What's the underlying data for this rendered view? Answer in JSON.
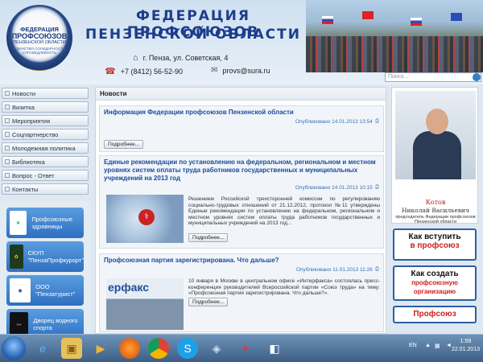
{
  "header": {
    "logo_line1": "ФЕДЕРАЦИЯ",
    "logo_line2": "ПРОФСОЮЗОВ",
    "logo_line3": "ПЕНЗЕНСКОЙ ОБЛАСТИ",
    "logo_line4": "ЕДИНСТВО СОЛИДАРНОСТЬ СПРАВЕДЛИВОСТЬ",
    "title_line1": "ФЕДЕРАЦИЯ ПРОФСОЮЗОВ",
    "title_line2": "ПЕНЗЕНСКОЙ ОБЛАСТИ",
    "address": "г. Пенза, ул. Советская, 4",
    "phone": "+7 (8412) 56-52-90",
    "email": "provs@sura.ru",
    "search_placeholder": "Поиск..."
  },
  "nav": {
    "items": [
      "Новости",
      "Визитка",
      "Мероприятия",
      "Соцпартнерство",
      "Молодежная политика",
      "Библиотека",
      "Вопрос - Ответ",
      "Контакты"
    ]
  },
  "promos": [
    {
      "label": "Профсоюзные здравницы",
      "icon": "health-resort-icon"
    },
    {
      "label": "СКУП \"ПензаПрофкурорт\"",
      "icon": "resort-logo-icon"
    },
    {
      "label": "ООО \"Пензатурист\"",
      "icon": "tourist-logo-icon"
    },
    {
      "label": "Дворец водного спорта",
      "icon": "swimmer-icon"
    }
  ],
  "main": {
    "section_title": "Новости",
    "articles": [
      {
        "title": "Информация Федерации профсоюзов Пензенской области",
        "date": "Опубликовано 14.01.2013 13:54",
        "more": "Подробнее..."
      },
      {
        "title": "Единые рекомендации по установлению на федеральном, региональном и местном уровнях систем оплаты труда работников государственных и муниципальных учреждений на 2013 год",
        "date": "Опубликовано 14.01.2013 10:15",
        "body": "Решением Российской трехсторонней комиссии по регулированию социально-трудовых отношений от 21.12.2012, протокол №11 утверждены Единые рекомендации по установлению на федеральном, региональном и местном уровнях систем оплаты труда работников государственных и муниципальных учреждений на 2013 год...",
        "more": "Подробнее..."
      },
      {
        "title": "Профсоюзная партия зарегистрирована. Что дальше?",
        "date": "Опубликовано 11.01.2013 11:26",
        "body": "10 января в Москве в центральном офисе «Интерфакса» состоялась пресс-конференция руководителей Всероссийской партии «Союз труда» на тему: «Профсоюзная партия зарегистрирована. Что дальше?».",
        "more": "Подробнее...",
        "thumb_text": "ерфакс"
      }
    ]
  },
  "sidebar": {
    "name_surname": "Котов",
    "name_given": "Николай Васильевич",
    "position": "председатель Федерации профсоюзов Пензенской области",
    "boxes": [
      {
        "line1": "Как вступить",
        "line2": "в профсоюз"
      },
      {
        "line1": "Как создать",
        "line2": "профсоюзную организацию"
      },
      {
        "line1": "Профсоюз",
        "line2": ""
      }
    ]
  },
  "taskbar": {
    "lang": "EN",
    "time": "1:59",
    "date": "22.01.2013"
  },
  "colors": {
    "brand": "#1c3d8c",
    "link": "#1c4a9a",
    "accent_red": "#cc1f1f"
  }
}
